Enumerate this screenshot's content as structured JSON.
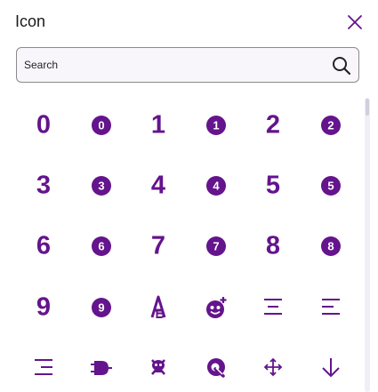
{
  "dialog": {
    "title": "Icon",
    "close_icon": "close-icon",
    "close_label": "Close"
  },
  "search": {
    "placeholder": "Search",
    "value": "",
    "icon": "search-icon"
  },
  "colors": {
    "accent": "#64148c",
    "scroll_track": "#f1eef6",
    "scroll_thumb": "#d4cde0"
  },
  "icons": [
    "numeric-0-icon",
    "numeric-0-circle-icon",
    "numeric-1-icon",
    "numeric-1-circle-icon",
    "numeric-2-icon",
    "numeric-2-circle-icon",
    "numeric-3-icon",
    "numeric-3-circle-icon",
    "numeric-4-icon",
    "numeric-4-circle-icon",
    "numeric-5-icon",
    "numeric-5-circle-icon",
    "numeric-6-icon",
    "numeric-6-circle-icon",
    "numeric-7-icon",
    "numeric-7-circle-icon",
    "numeric-8-icon",
    "numeric-8-circle-icon",
    "numeric-9-icon",
    "numeric-9-circle-icon",
    "ab-testing-icon",
    "abacus-icon",
    "align-center-icon",
    "align-left-icon",
    "align-right-icon",
    "and-gate-icon",
    "skull-crossbones-icon",
    "quora-icon",
    "arrows-move-icon",
    "arrow-down-icon"
  ]
}
